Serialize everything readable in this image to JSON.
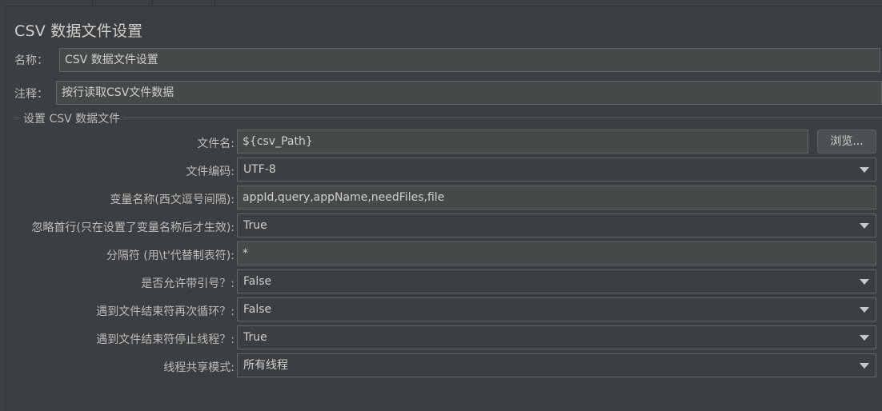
{
  "panel": {
    "title": "CSV 数据文件设置"
  },
  "name_row": {
    "label": "名称：",
    "value": "CSV 数据文件设置"
  },
  "comment_row": {
    "label": "注释：",
    "value": "按行读取CSV文件数据"
  },
  "group": {
    "title": "设置 CSV 数据文件"
  },
  "fields": {
    "filename": {
      "label": "文件名:",
      "value": "${csv_Path}",
      "browse_label": "浏览..."
    },
    "encoding": {
      "label": "文件编码:",
      "value": "UTF-8"
    },
    "var_names": {
      "label": "变量名称(西文逗号间隔):",
      "value": "appId,query,appName,needFiles,file"
    },
    "ignore_first": {
      "label": "忽略首行(只在设置了变量名称后才生效):",
      "value": "True"
    },
    "delimiter": {
      "label": "分隔符 (用\\t'代替制表符):",
      "value": "*"
    },
    "allow_quoted": {
      "label": "是否允许带引号？:",
      "value": "False"
    },
    "recycle_eof": {
      "label": "遇到文件结束符再次循环？:",
      "value": "False"
    },
    "stop_thread_eof": {
      "label": "遇到文件结束符停止线程？:",
      "value": "True"
    },
    "sharing_mode": {
      "label": "线程共享模式:",
      "value": "所有线程"
    }
  },
  "icons": {
    "dropdown": "chevron-down-icon"
  }
}
